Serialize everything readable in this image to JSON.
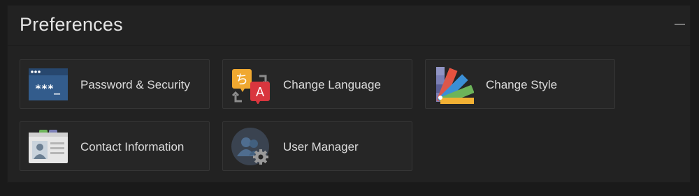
{
  "panel": {
    "title": "Preferences",
    "collapse_icon": "minus-icon"
  },
  "tiles": [
    {
      "label": "Password & Security",
      "icon": "password-security-icon"
    },
    {
      "label": "Change Language",
      "icon": "change-language-icon"
    },
    {
      "label": "Change Style",
      "icon": "change-style-icon"
    },
    {
      "label": "Contact Information",
      "icon": "contact-information-icon"
    },
    {
      "label": "User Manager",
      "icon": "user-manager-icon"
    }
  ],
  "icon_text": {
    "password_mask": "***_",
    "lang_source": "ち",
    "lang_target": "A"
  },
  "colors": {
    "background": "#1a1a1a",
    "panel": "#222222",
    "tile": "#262626",
    "text": "#dcdcdc"
  }
}
